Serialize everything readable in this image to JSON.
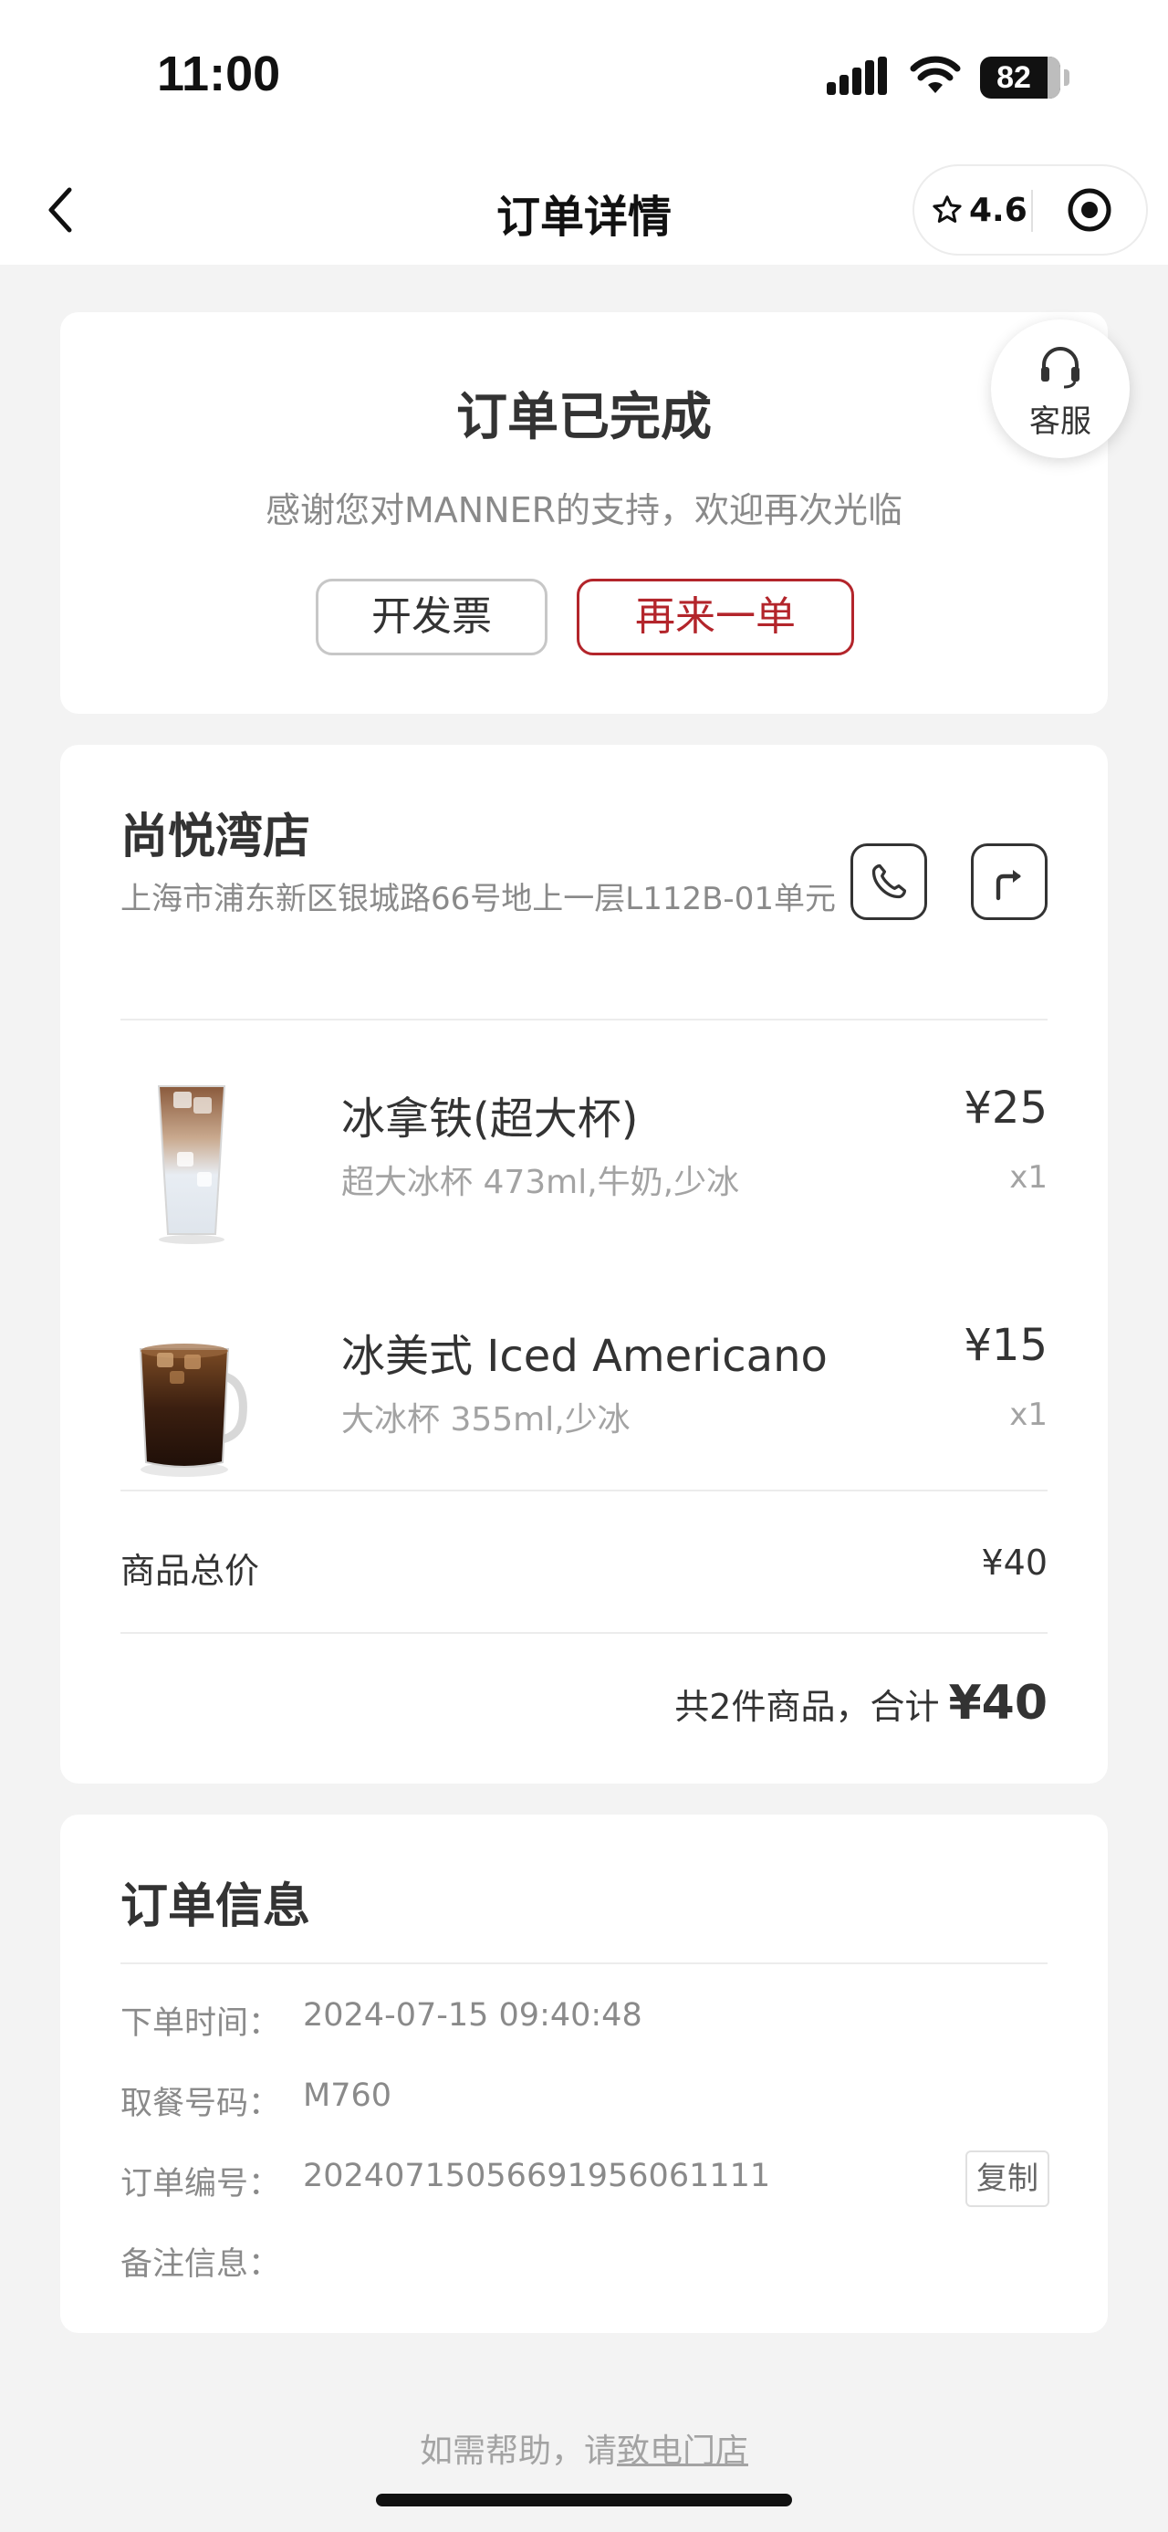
{
  "status_bar": {
    "time": "11:00",
    "battery": "82"
  },
  "nav": {
    "title": "订单详情",
    "rating": "4.6"
  },
  "order_status": {
    "title": "订单已完成",
    "subtitle": "感谢您对MANNER的支持，欢迎再次光临",
    "invoice_button": "开发票",
    "reorder_button": "再来一单"
  },
  "customer_service": {
    "label": "客服"
  },
  "store": {
    "name": "尚悦湾店",
    "address": "上海市浦东新区银城路66号地上一层L112B-01单元"
  },
  "items": [
    {
      "name": "冰拿铁(超大杯)",
      "spec": "超大冰杯 473ml,牛奶,少冰",
      "price": "¥25",
      "qty": "x1"
    },
    {
      "name": "冰美式 Iced Americano",
      "spec": "大冰杯 355ml,少冰",
      "price": "¥15",
      "qty": "x1"
    }
  ],
  "summary": {
    "subtotal_label": "商品总价",
    "subtotal_value": "¥40",
    "total_text": "共2件商品，合计",
    "total_amount": "¥40"
  },
  "order_info": {
    "title": "订单信息",
    "rows": [
      {
        "label": "下单时间：",
        "value": "2024-07-15 09:40:48"
      },
      {
        "label": "取餐号码：",
        "value": "M760"
      },
      {
        "label": "订单编号：",
        "value": "20240715056691956061111"
      },
      {
        "label": "备注信息：",
        "value": ""
      }
    ],
    "copy_button": "复制"
  },
  "footer": {
    "help_text": "如需帮助，请",
    "help_link": "致电门店"
  }
}
